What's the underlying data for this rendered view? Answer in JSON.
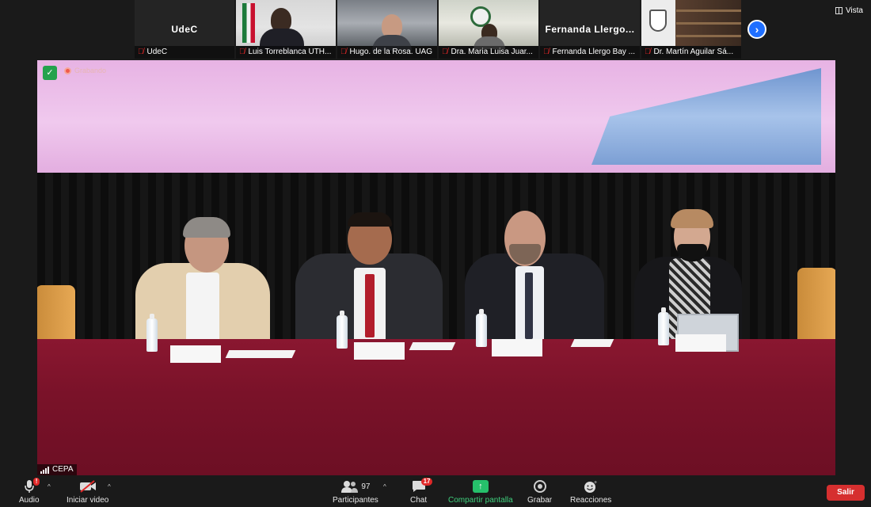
{
  "thumbnails": [
    {
      "big_name": "UdeC",
      "caption": "UdeC",
      "muted": true
    },
    {
      "big_name": "",
      "caption": "Luis Torreblanca UTH...",
      "muted": true
    },
    {
      "big_name": "",
      "caption": "Hugo. de la Rosa. UAG",
      "muted": true
    },
    {
      "big_name": "",
      "caption": "Dra. Maria Luisa Juar...",
      "muted": true
    },
    {
      "big_name": "Fernanda  Llergo...",
      "caption": "Fernanda Llergo Bay ...",
      "muted": true
    },
    {
      "big_name": "",
      "caption": "Dr. Martín Aguilar Sá...",
      "muted": true
    }
  ],
  "view_label": "Vista",
  "recording_label": "Grabando",
  "active_speaker": "CEPA",
  "toolbar": {
    "audio_label": "Audio",
    "audio_badge": "!",
    "video_label": "Iniciar video",
    "participants_label": "Participantes",
    "participants_count": "97",
    "chat_label": "Chat",
    "chat_badge": "17",
    "share_label": "Compartir pantalla",
    "record_label": "Grabar",
    "reactions_label": "Reacciones",
    "exit_label": "Salir"
  },
  "colors": {
    "share_green": "#26c06b",
    "exit_red": "#d62f2f",
    "next_blue": "#1f6fff",
    "security_green": "#23a24d"
  }
}
